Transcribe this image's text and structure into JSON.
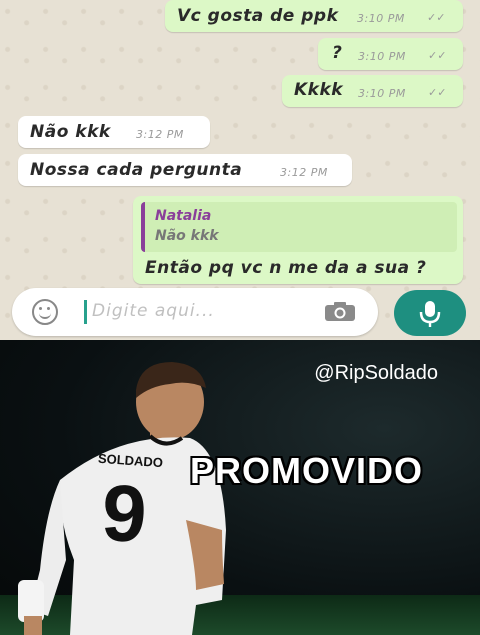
{
  "chat": {
    "messages": [
      {
        "text": "Vc gosta de ppk",
        "time": "3:10 PM",
        "ticks": "✓✓"
      },
      {
        "text": "?",
        "time": "3:10 PM",
        "ticks": "✓✓"
      },
      {
        "text": "Kkkk",
        "time": "3:10 PM",
        "ticks": "✓✓"
      },
      {
        "text": "Não kkk",
        "time": "3:12 PM"
      },
      {
        "text": "Nossa cada pergunta",
        "time": "3:12 PM"
      },
      {
        "quote_name": "Natalia",
        "quote_text": "Não kkk",
        "text": "Então pq vc n me da a sua ?"
      }
    ]
  },
  "input": {
    "placeholder": "Digite aqui..."
  },
  "icons": {
    "emoji": "emoji-icon",
    "camera": "camera-icon",
    "mic": "mic-icon"
  },
  "colors": {
    "outgoing": "#dcf8c6",
    "incoming": "#ffffff",
    "mic_button": "#1e8f80",
    "quote_bar": "#8a3f9a"
  },
  "meme": {
    "handle": "@RipSoldado",
    "caption": "PROMOVIDO",
    "jersey_name": "SOLDADO",
    "jersey_number": "9"
  }
}
